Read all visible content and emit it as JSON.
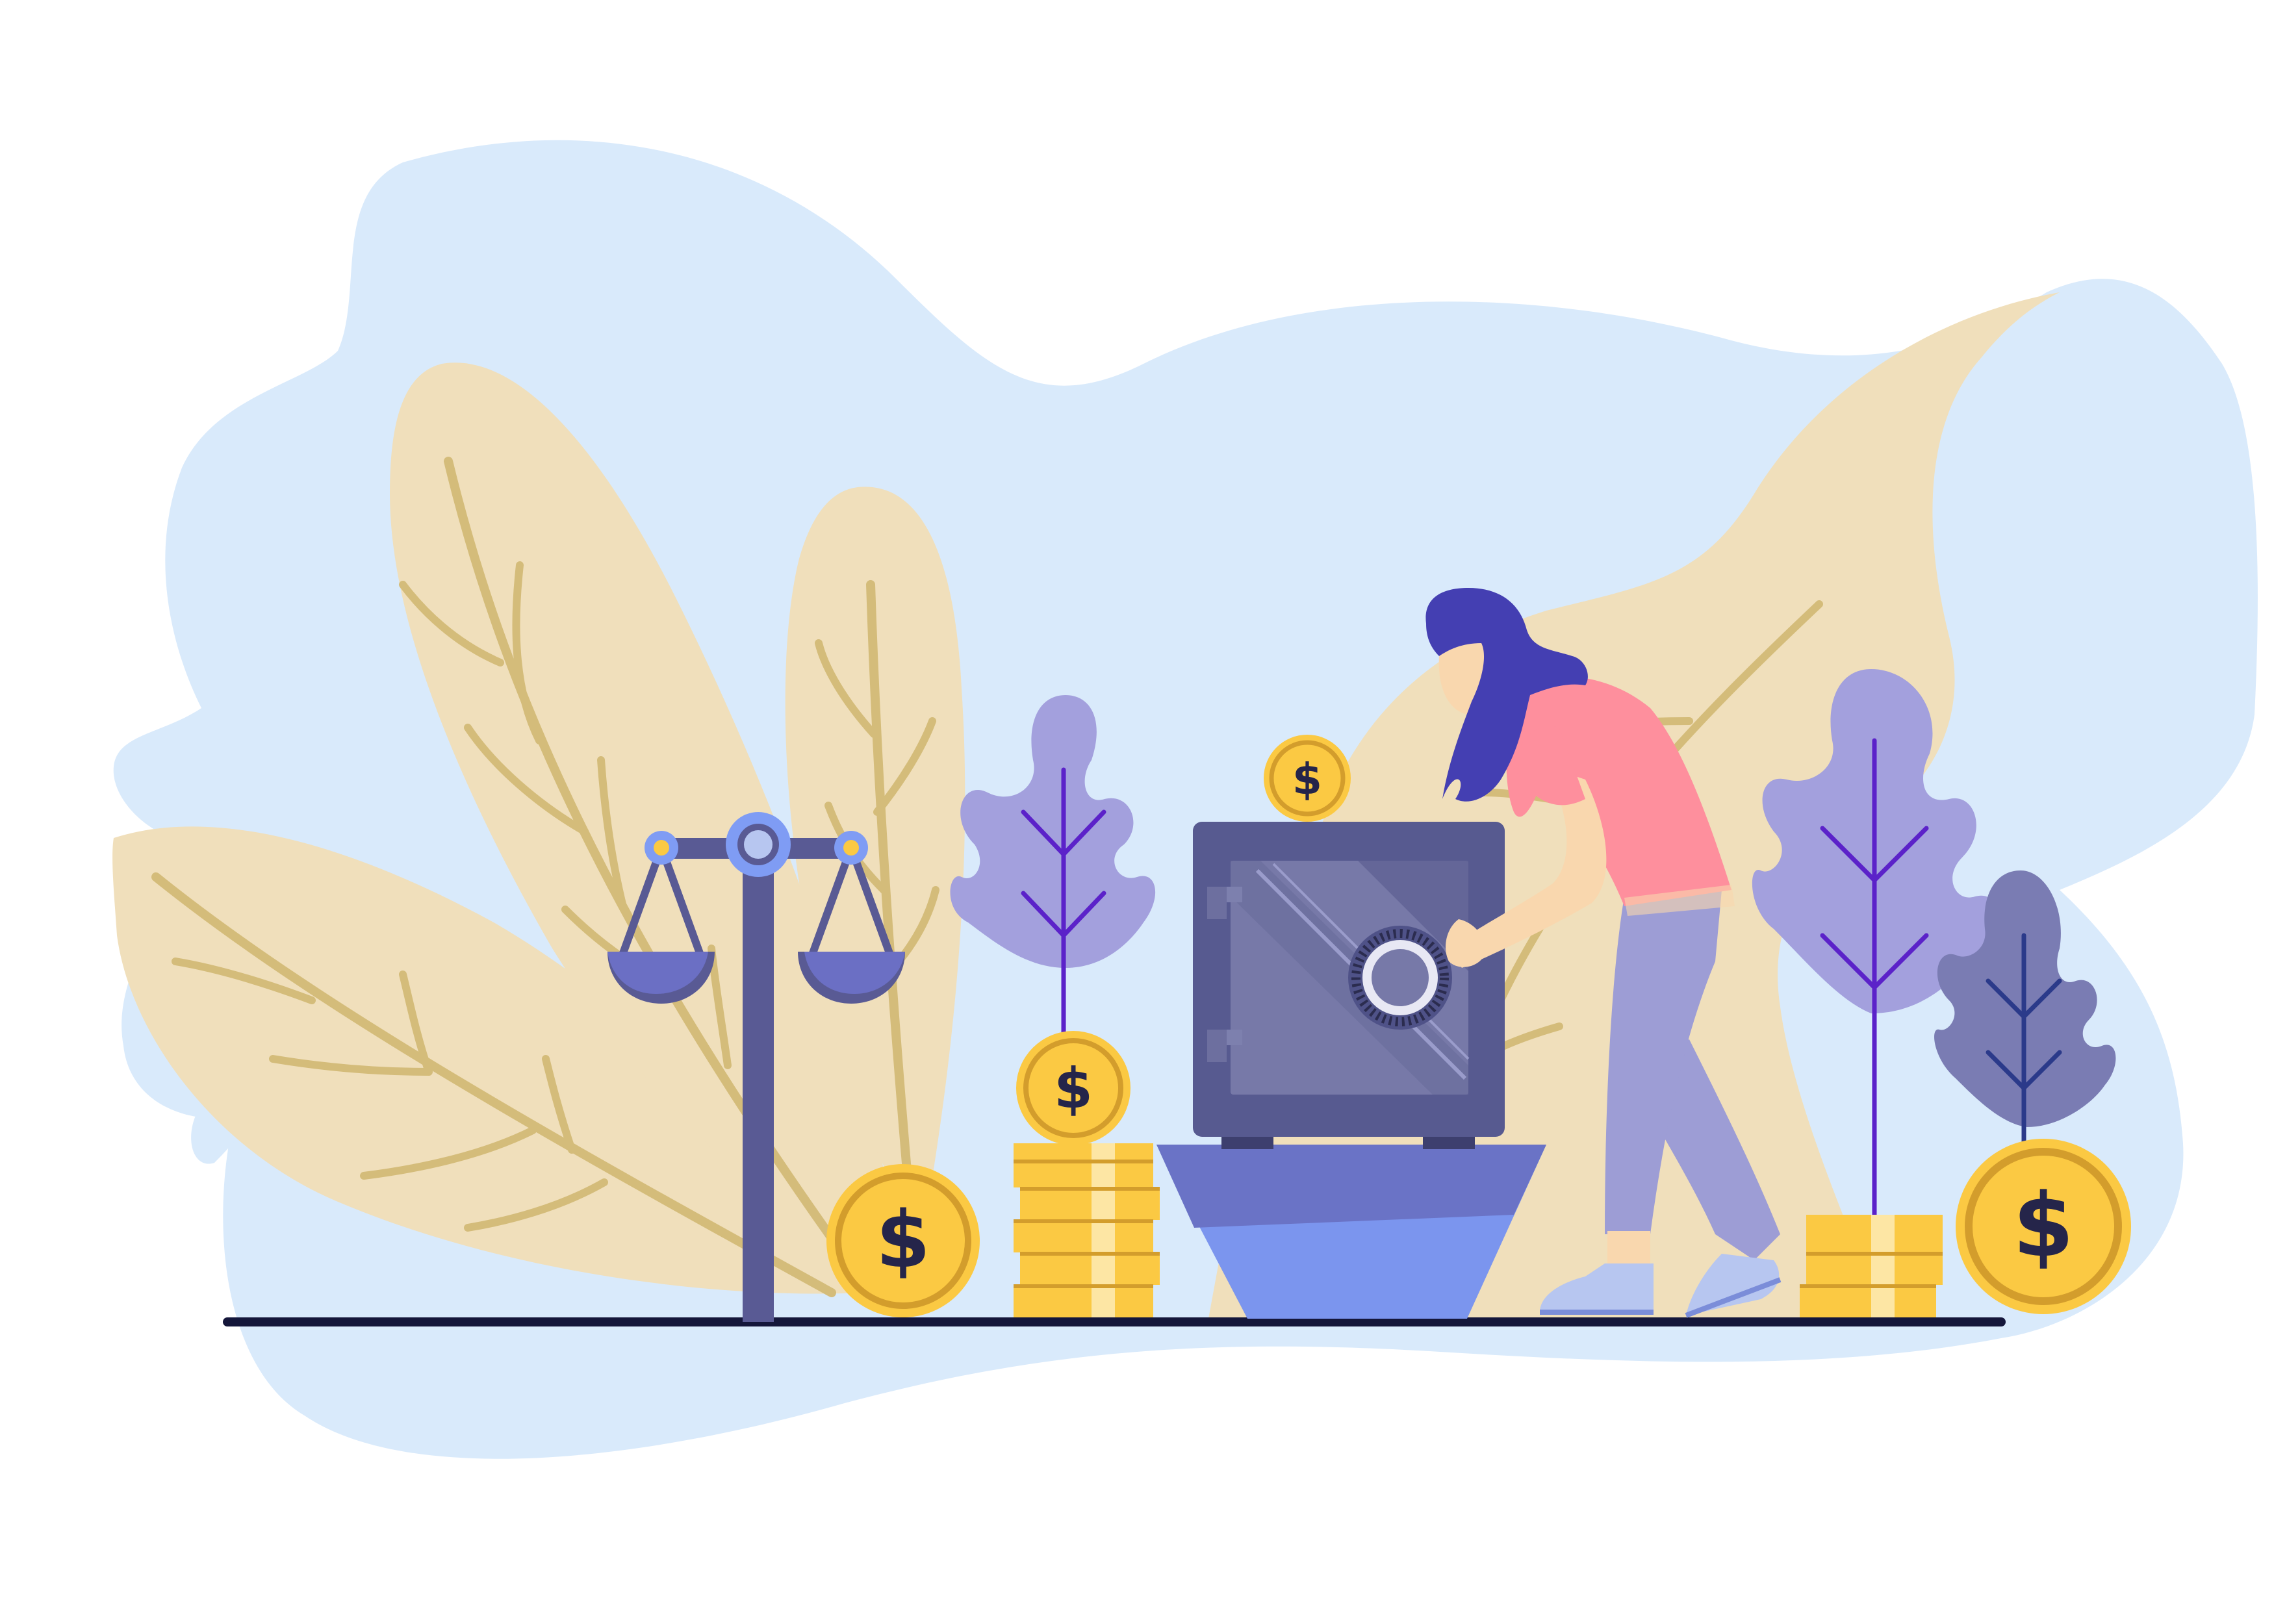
{
  "colors": {
    "background": "#ffffff",
    "blob": "#d9eafb",
    "leaf_beige": "#f0dfbb",
    "leaf_vein": "#d4bc7a",
    "plant_lavender": "#a3a0dd",
    "plant_dark": "#7a7cb3",
    "stem_purple": "#5b22c9",
    "coin_gold": "#fbc943",
    "coin_rim": "#d39d2c",
    "coin_text": "#25254a",
    "safe_dark": "#575a90",
    "safe_face": "#7779a8",
    "pedestal_top": "#6a73c6",
    "pedestal_bottom": "#7b95ee",
    "hair": "#443fb2",
    "skin": "#f9d7ae",
    "shirt": "#fe8f9d",
    "pants": "#9d9dd5",
    "shoe": "#b7c6f0",
    "ground": "#14163a",
    "scale_frame": "#595a94",
    "scale_pan": "#6b6fc4",
    "scale_accent": "#7f9cf4"
  },
  "coins": {
    "symbol": "$"
  },
  "icons": {
    "balance_scale": "balance-scale-icon",
    "safe": "safe-icon",
    "coin": "dollar-coin-icon"
  }
}
